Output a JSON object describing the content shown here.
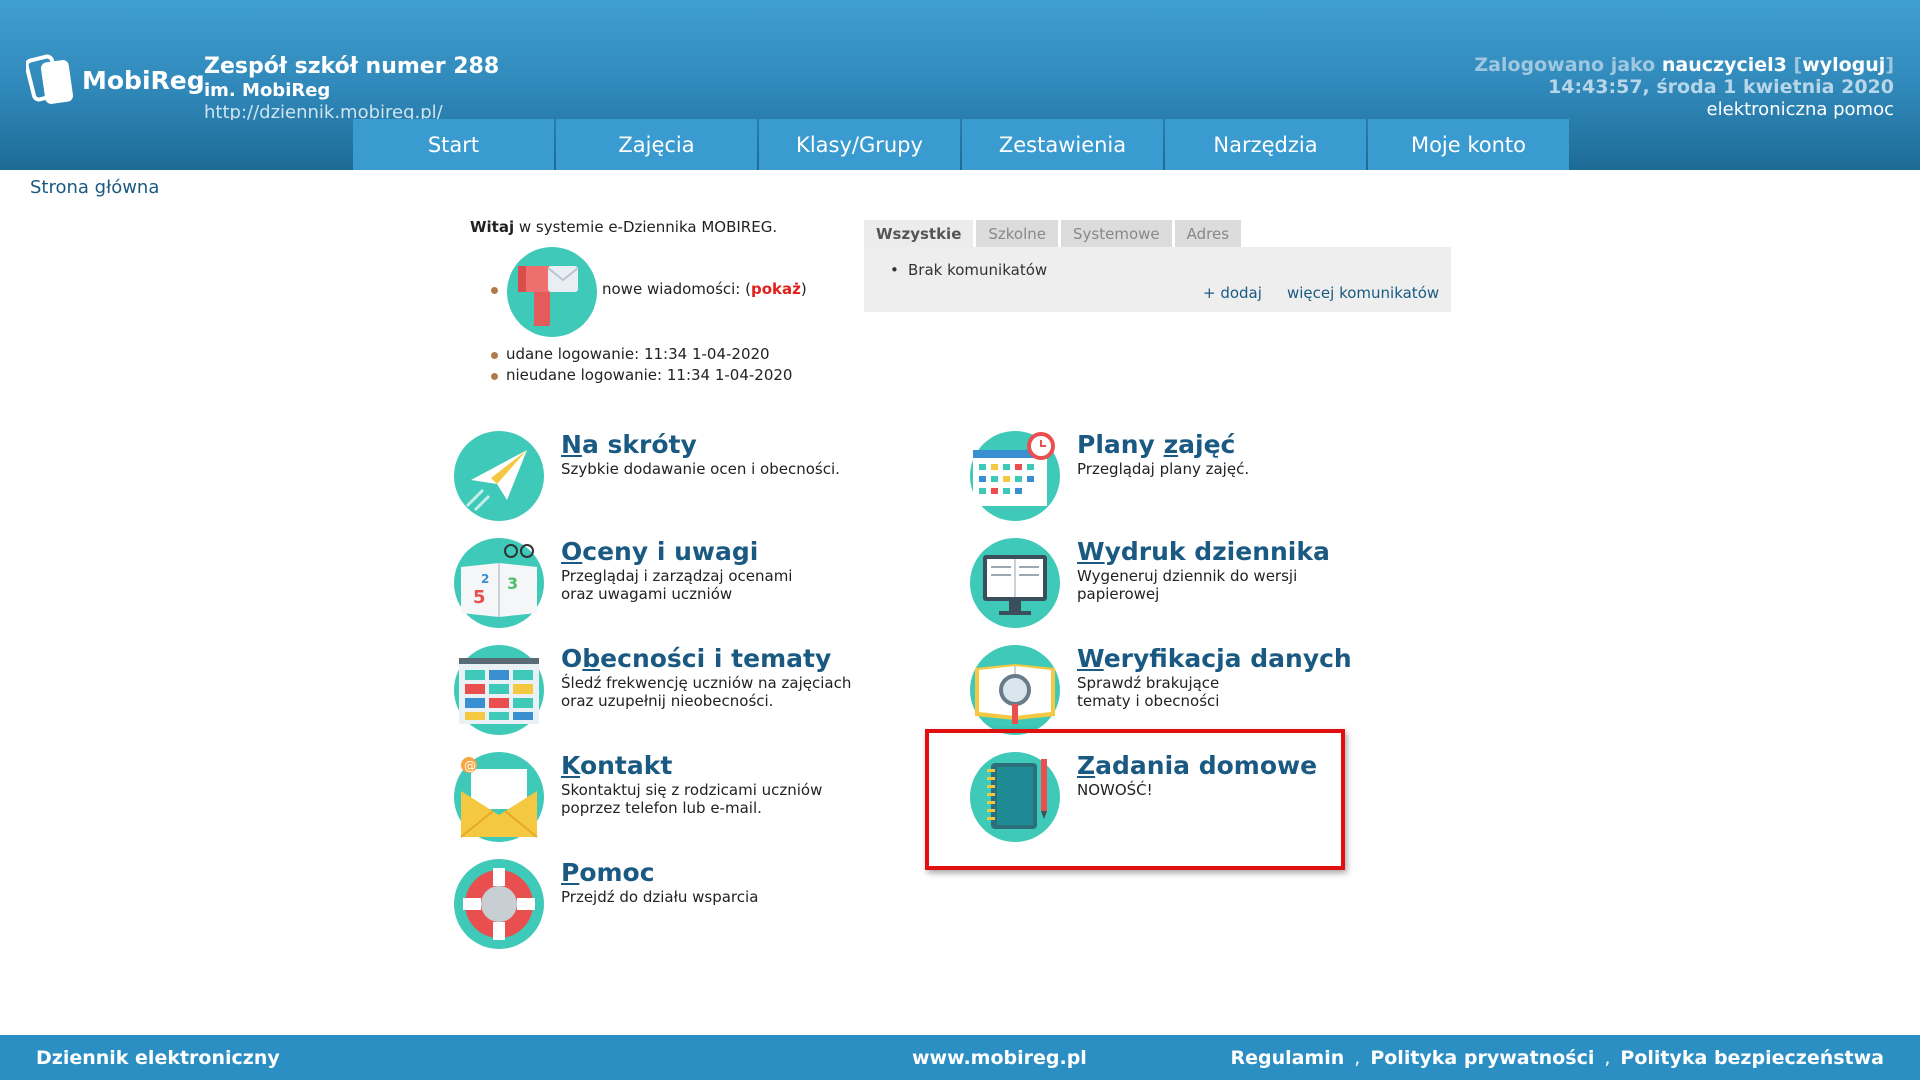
{
  "header": {
    "logo_text": "MobiReg",
    "school_name": "Zespół szkół numer 288",
    "school_sub": "im. MobiReg",
    "school_url": "http://dziennik.mobireg.pl/",
    "logged_as_label": "Zalogowano jako",
    "username": "nauczyciel3",
    "logout": "wyloguj",
    "datetime": "14:43:57, środa 1 kwietnia 2020",
    "help_link": "elektroniczna pomoc"
  },
  "nav": {
    "items": [
      "Start",
      "Zajęcia",
      "Klasy/Grupy",
      "Zestawienia",
      "Narzędzia",
      "Moje konto"
    ]
  },
  "breadcrumb": "Strona główna",
  "welcome": {
    "greeting_bold": "Witaj",
    "greeting_rest": " w systemie e-Dziennika MOBIREG.",
    "new_messages_label": "nowe wiadomości: (",
    "show_link": "pokaż",
    "new_messages_close": ")",
    "login_ok": "udane logowanie: 11:34 1-04-2020",
    "login_bad": "nieudane logowanie: 11:34 1-04-2020"
  },
  "announcements": {
    "tabs": [
      "Wszystkie",
      "Szkolne",
      "Systemowe",
      "Adres"
    ],
    "item": "Brak komunikatów",
    "add": "+ dodaj",
    "more": "więcej komunikatów"
  },
  "tiles": {
    "shortcuts": {
      "first": "N",
      "rest": "a skróty",
      "desc": "Szybkie dodawanie ocen i obecności."
    },
    "grades": {
      "first": "O",
      "rest": "ceny i uwagi",
      "desc1": "Przeglądaj i zarządzaj ocenami",
      "desc2": "oraz uwagami uczniów"
    },
    "attendance": {
      "first": "O",
      "ul": "b",
      "rest": "ecności i tematy",
      "desc1": "Śledź frekwencję uczniów na zajęciach",
      "desc2": "oraz uzupełnij nieobecności."
    },
    "contact": {
      "first": "K",
      "rest": "ontakt",
      "desc1": "Skontaktuj się z rodzicami uczniów",
      "desc2": "poprzez telefon lub e-mail."
    },
    "help": {
      "first": "P",
      "rest": "omoc",
      "desc": "Przejdź do działu wsparcia"
    },
    "plans": {
      "pre": "Plany ",
      "first": "z",
      "rest": "ajęć",
      "desc": "Przeglądaj plany zajęć."
    },
    "print": {
      "first": "W",
      "rest": "ydruk dziennika",
      "desc1": "Wygeneruj dziennik do wersji",
      "desc2": "papierowej"
    },
    "verify": {
      "first": "W",
      "rest": "eryfikacja danych",
      "desc1": "Sprawdź brakujące",
      "desc2": "tematy i obecności"
    },
    "homework": {
      "first": "Z",
      "rest": "adania domowe",
      "desc": "NOWOŚĆ!"
    }
  },
  "footer": {
    "left": "Dziennik elektroniczny",
    "center": "www.mobireg.pl",
    "links": [
      "Regulamin",
      "Polityka prywatności",
      "Polityka bezpieczeństwa"
    ],
    "sep": ","
  },
  "colors": {
    "header": "#2f87b8",
    "nav": "#3a9bd0",
    "teal": "#3ec9b8",
    "link": "#1a5a82",
    "highlight": "#e01010",
    "footer": "#2b8fc4"
  }
}
